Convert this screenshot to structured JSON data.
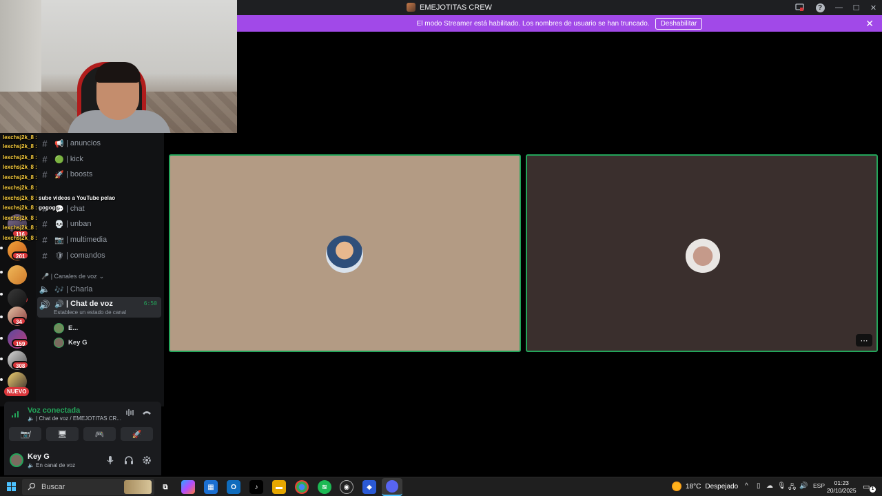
{
  "window": {
    "title": "EMEJOTITAS CREW",
    "help_label": "?",
    "min_label": "—",
    "max_label": "☐",
    "close_label": "✕"
  },
  "banner": {
    "text": "El modo Streamer está habilitado. Los nombres de usuario se han truncado.",
    "button": "Deshabilitar",
    "close": "✕"
  },
  "rail": {
    "badges": [
      "116",
      "201",
      "196",
      "34",
      "159",
      "308"
    ],
    "nuevo": "NUEVO"
  },
  "chat_overlay": {
    "lines": [
      {
        "user": "lexchsj2k_8 :",
        "msg": ""
      },
      {
        "user": "lexchsj2k_8 :",
        "msg": ""
      },
      {
        "user": "lexchsj2k_8 :",
        "msg": ""
      },
      {
        "user": "lexchsj2k_8 :",
        "msg": ""
      },
      {
        "user": "lexchsj2k_8 :",
        "msg": ""
      },
      {
        "user": "lexchsj2k_8 :",
        "msg": ""
      },
      {
        "user": "lexchsj2k_8 :",
        "msg": "sube videos a YouTube pelao"
      },
      {
        "user": "lexchsj2k_8 :",
        "msg": "gogogo"
      },
      {
        "user": "lexchsj2k_8 :",
        "msg": ""
      },
      {
        "user": "lexchsj2k_8 :",
        "msg": ""
      },
      {
        "user": "lexchsj2k_8 :",
        "msg": ""
      }
    ]
  },
  "channels": {
    "text": [
      {
        "emoji": "📢",
        "name": "| anuncios"
      },
      {
        "emoji": "🟢",
        "name": "| kick"
      },
      {
        "emoji": "🚀",
        "name": "| boosts"
      },
      {
        "emoji": "💬",
        "name": "| chat"
      },
      {
        "emoji": "💀",
        "name": "| unban"
      },
      {
        "emoji": "📷",
        "name": "| multimedia"
      },
      {
        "emoji": "🛡",
        "name": "| comandos"
      }
    ],
    "category": "🎤 | Canales de voz",
    "voice": [
      {
        "emoji": "🎶",
        "name": "| Charla"
      },
      {
        "emoji": "🔊",
        "name": "| Chat de voz",
        "time": "6:50",
        "status": "Establece un estado de canal"
      }
    ],
    "voice_users": [
      "E...",
      "Key G"
    ]
  },
  "voice_panel": {
    "title": "Voz conectada",
    "subtitle": "🔈 | Chat de voz / EMEJOTITAS CR...",
    "buttons": [
      "📷̸",
      "🖥",
      "🎮",
      "🚀"
    ]
  },
  "user_panel": {
    "name": "Key G",
    "status": "🔈 En canal de voz"
  },
  "stage": {
    "more": "⋯"
  },
  "taskbar": {
    "search_placeholder": "Buscar",
    "weather_temp": "18°C",
    "weather_text": "Despejado",
    "language": "ESP",
    "time": "01:23",
    "date": "20/10/2025",
    "notif_count": "1"
  },
  "colors": {
    "banner": "#a149e8",
    "speaking": "#23a55a",
    "tile1": "#b39b84",
    "tile2": "#3a2f2d"
  }
}
